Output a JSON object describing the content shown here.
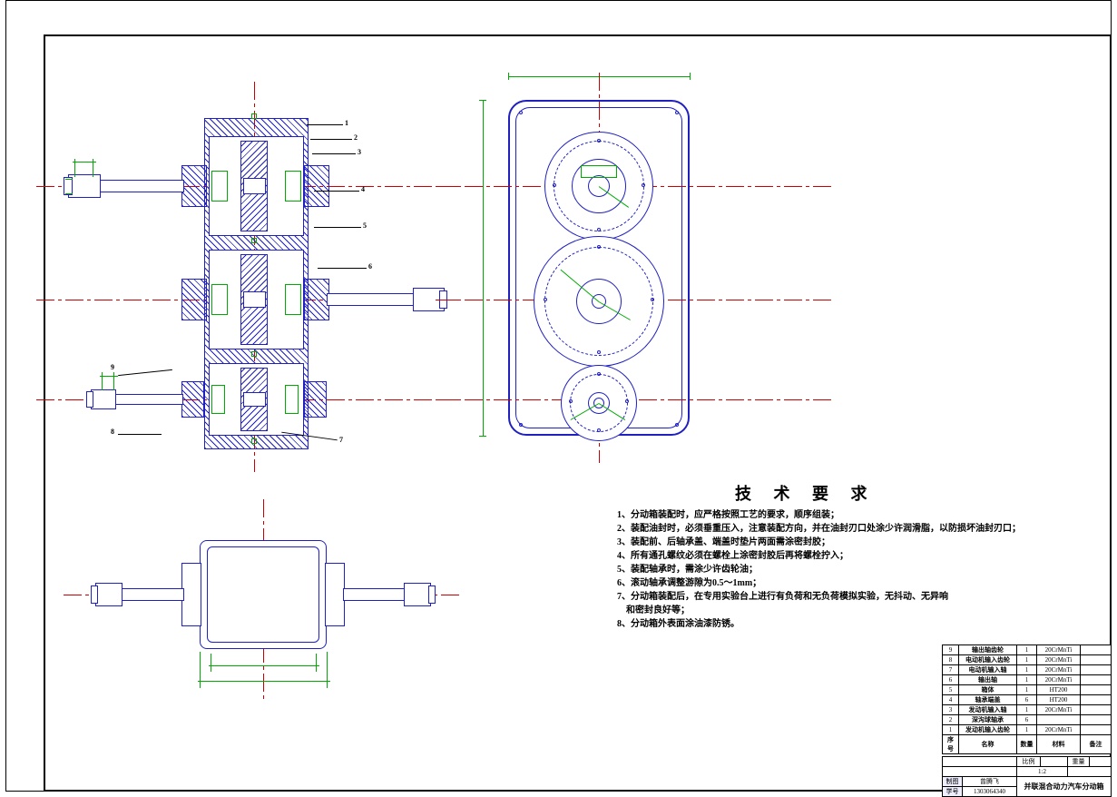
{
  "tech": {
    "title": "技 术 要 求",
    "lines": [
      "1、分动箱装配时，应严格按照工艺的要求，顺序组装；",
      "2、装配油封时，必须垂重压入，注意装配方向，并在油封刃口处涂少许润滑脂，以防损坏油封刃口；",
      "3、装配前、后轴承盖、端盖时垫片两面需涂密封胶；",
      "4、所有通孔螺纹必须在螺栓上涂密封胶后再将螺栓拧入；",
      "5、装配轴承时，需涂少许齿轮油；",
      "6、滚动轴承调整游隙为0.5～1mm；",
      "7、分动箱装配后，在专用实验台上进行有负荷和无负荷模拟实验，无抖动、无异响",
      "    和密封良好等；",
      "8、分动箱外表面涂油漆防锈。"
    ]
  },
  "bom": {
    "rows": [
      {
        "n": "9",
        "name": "输出轴齿轮",
        "qty": "1",
        "mat": "20CrMnTi",
        "note": ""
      },
      {
        "n": "8",
        "name": "电动机输入齿轮",
        "qty": "1",
        "mat": "20CrMnTi",
        "note": ""
      },
      {
        "n": "7",
        "name": "电动机输入轴",
        "qty": "1",
        "mat": "20CrMnTi",
        "note": ""
      },
      {
        "n": "6",
        "name": "输出轴",
        "qty": "1",
        "mat": "20CrMnTi",
        "note": ""
      },
      {
        "n": "5",
        "name": "箱体",
        "qty": "1",
        "mat": "HT200",
        "note": ""
      },
      {
        "n": "4",
        "name": "轴承端盖",
        "qty": "6",
        "mat": "HT200",
        "note": ""
      },
      {
        "n": "3",
        "name": "发动机输入轴",
        "qty": "1",
        "mat": "20CrMnTi",
        "note": ""
      },
      {
        "n": "2",
        "name": "深沟球轴承",
        "qty": "6",
        "mat": "",
        "note": ""
      },
      {
        "n": "1",
        "name": "发动机输入齿轮",
        "qty": "1",
        "mat": "20CrMnTi",
        "note": ""
      }
    ],
    "header": {
      "n": "序号",
      "name": "名称",
      "qty": "数量",
      "mat": "材料",
      "note": "备注"
    }
  },
  "title_block": {
    "scale_label": "比例",
    "scale": "1:2",
    "mass_label": "重量",
    "mass": "",
    "design_label": "制图",
    "designer": "曾腾飞",
    "num_label": "学号",
    "num": "1303064340",
    "title": "并联混合动力汽车分动箱"
  },
  "balloons": {
    "b1": "1",
    "b2": "2",
    "b3": "3",
    "b4": "4",
    "b5": "5",
    "b6": "6",
    "b7": "7",
    "b8": "8",
    "b9": "9"
  }
}
